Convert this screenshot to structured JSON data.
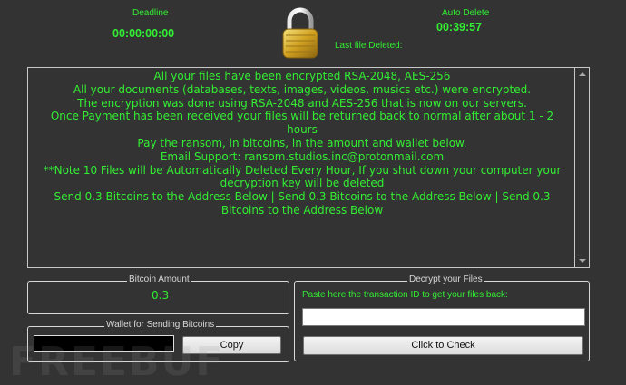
{
  "timers": {
    "deadline_label": "Deadline",
    "deadline_value": "00:00:00:00",
    "auto_delete_label": "Auto Delete",
    "auto_delete_value": "00:39:57",
    "last_file_label": "Last file Deleted:"
  },
  "message": {
    "lines": [
      "All your files have been encrypted RSA-2048, AES-256",
      "All your documents (databases, texts, images, videos, musics etc.) were encrypted.",
      "The encryption was done using RSA-2048 and AES-256 that is now on our servers.",
      "Once Payment has been received your files will be returned back to normal after about 1 - 2 hours",
      "Pay the ransom, in bitcoins, in the amount and wallet below.",
      "Email Support: ransom.studios.inc@protonmail.com",
      "**Note 10 Files will be Automatically Deleted Every Hour, If you shut down your computer your decryption key will be deleted",
      "Send 0.3 Bitcoins to the Address Below | Send 0.3 Bitcoins to the Address Below | Send 0.3 Bitcoins to the Address Below"
    ]
  },
  "bitcoin": {
    "title": "Bitcoin Amount",
    "amount": "0.3"
  },
  "wallet": {
    "title": "Wallet for Sending Bitcoins",
    "address_value": "",
    "copy_label": "Copy"
  },
  "decrypt": {
    "title": "Decrypt your Files",
    "instruction": "Paste here the transaction ID to get your files back:",
    "transaction_value": "",
    "check_label": "Click to Check"
  },
  "watermark": "FREEBUF",
  "colors": {
    "accent_green": "#33ee33",
    "background": "#333333"
  },
  "icons": {
    "lock": "padlock-icon"
  }
}
